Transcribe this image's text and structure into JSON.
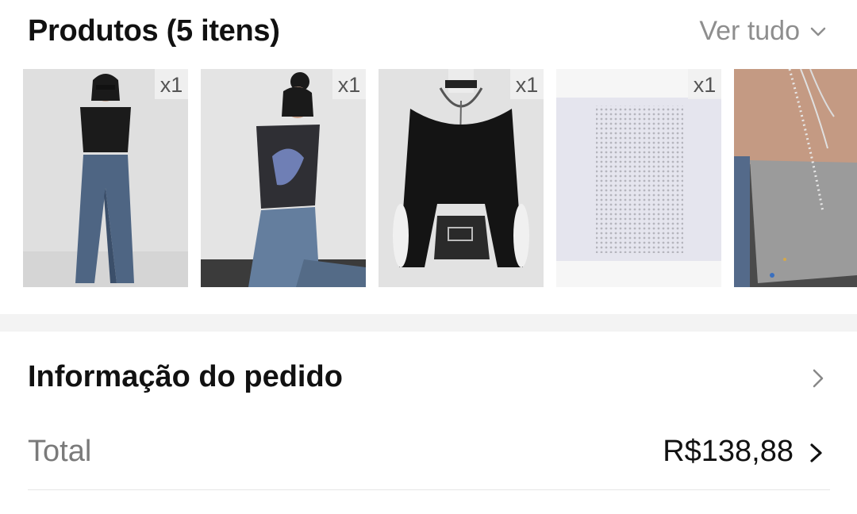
{
  "products": {
    "title": "Produtos (5 itens)",
    "see_all_label": "Ver tudo",
    "items": [
      {
        "qty": "x1",
        "icon": "product-image-wide-jeans-top"
      },
      {
        "qty": "x1",
        "icon": "product-image-floral-tee"
      },
      {
        "qty": "x1",
        "icon": "product-image-bell-sleeve-top"
      },
      {
        "qty": "x1",
        "icon": "product-image-rhinestone-sticker-sheet"
      },
      {
        "qty": "",
        "icon": "product-image-tube-top-necklaces"
      }
    ]
  },
  "order_info": {
    "title": "Informação do pedido"
  },
  "total": {
    "label": "Total",
    "value": "R$138,88"
  }
}
